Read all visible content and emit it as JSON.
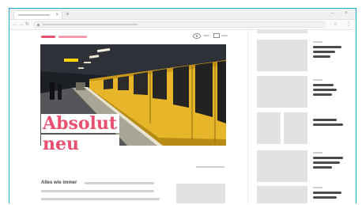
{
  "browser": {
    "tab_close": "×",
    "new_tab": "+",
    "window_controls": [
      "–",
      "×"
    ],
    "nav_back": "←",
    "nav_forward": "→",
    "nav_reload": "↻",
    "toolbar_star": "☆",
    "toolbar_menu": "⋮"
  },
  "article": {
    "headline_lines": [
      "Absolut",
      "neu"
    ],
    "kicker": "Alles wie immer"
  },
  "colors": {
    "accent": "#e8506f",
    "accent_light": "#f29aae",
    "frame_border": "#1eaad1",
    "placeholder": "#e2e2e2",
    "text_dark": "#4a4a4a",
    "train_yellow": "#e7b52a"
  }
}
